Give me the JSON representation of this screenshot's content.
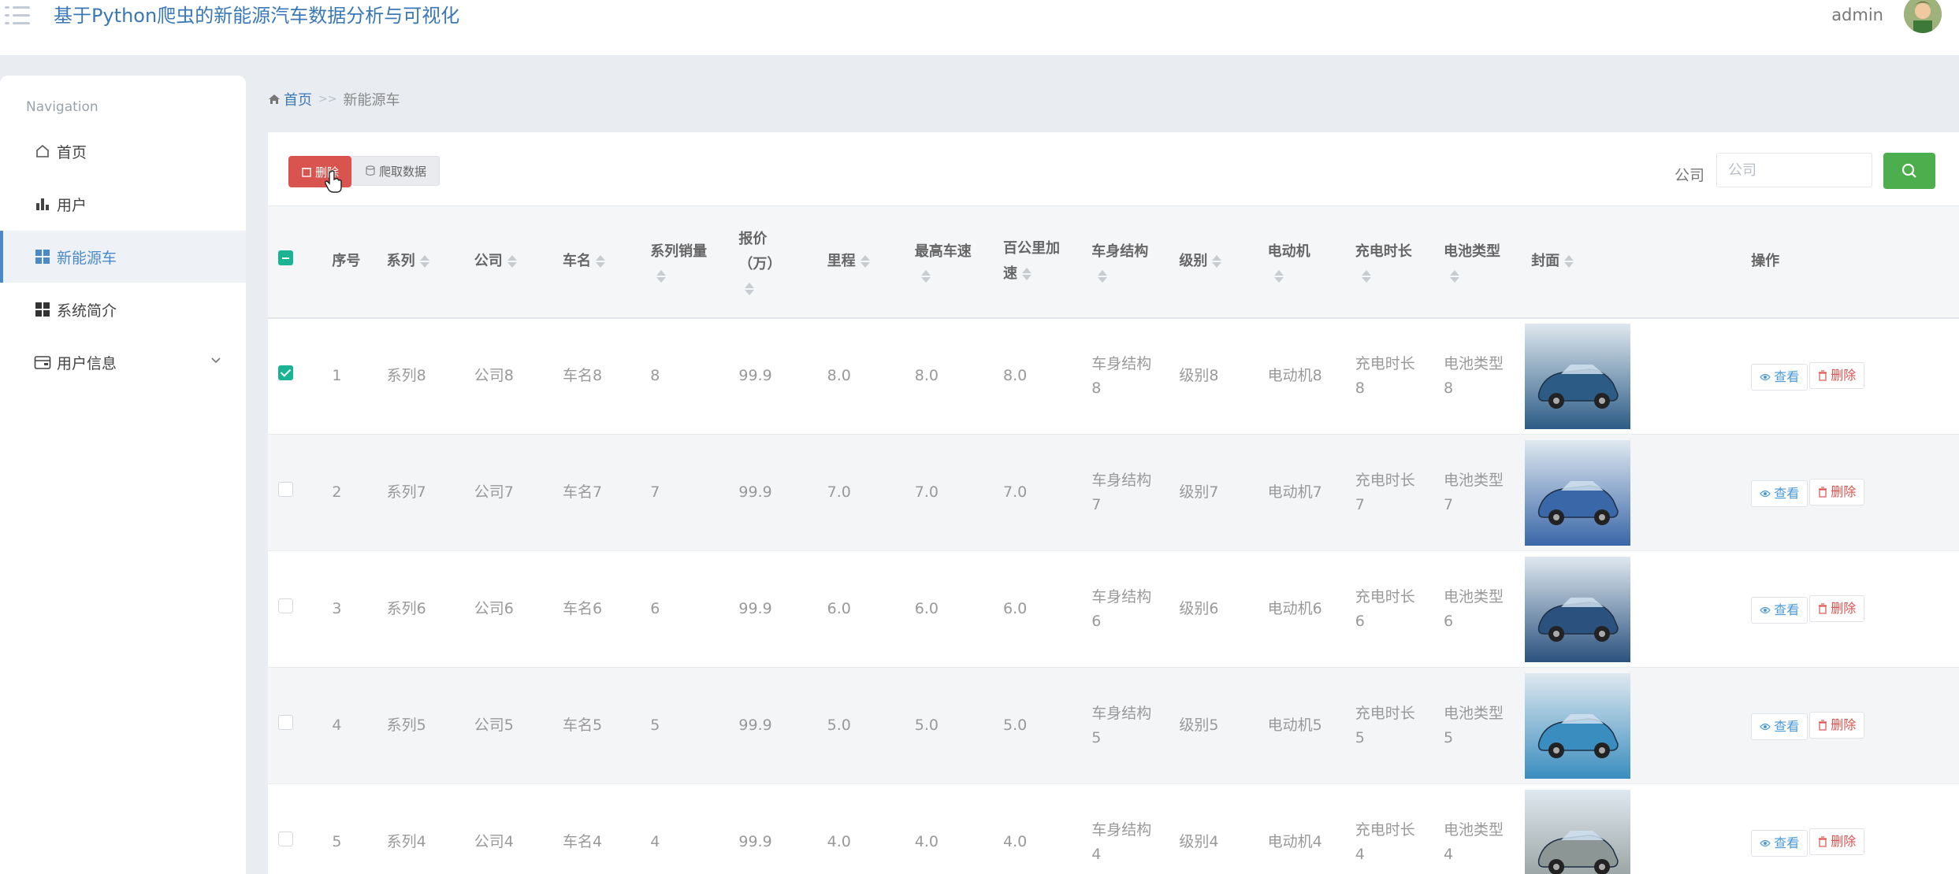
{
  "header": {
    "app_title": "基于Python爬虫的新能源汽车数据分析与可视化",
    "username": "admin",
    "menu_icon": "hamburger-icon",
    "avatar_icon": "user-avatar"
  },
  "sidebar": {
    "header": "Navigation",
    "items": [
      {
        "label": "首页",
        "icon": "home-icon"
      },
      {
        "label": "用户",
        "icon": "bar-chart-icon"
      },
      {
        "label": "新能源车",
        "icon": "grid-icon"
      },
      {
        "label": "系统简介",
        "icon": "grid-icon"
      },
      {
        "label": "用户信息",
        "icon": "wallet-icon"
      }
    ],
    "active_index": 2
  },
  "breadcrumb": {
    "home": "首页",
    "separator": ">>",
    "current": "新能源车"
  },
  "toolbar": {
    "delete_label": "删除",
    "crawl_label": "爬取数据",
    "search_label": "公司",
    "search_placeholder": "公司"
  },
  "table": {
    "headers": {
      "index": "序号",
      "series": "系列",
      "company": "公司",
      "car_name": "车名",
      "series_sales_1": "系列销量",
      "price_1": "报价",
      "price_2": "（万）",
      "range": "里程",
      "max_speed_1": "最高车速",
      "accel_1": "百公里加",
      "accel_2": "速",
      "body": "车身结构",
      "level": "级别",
      "motor": "电动机",
      "charge_time": "充电时长",
      "battery": "电池类型",
      "cover": "封面",
      "actions": "操作"
    },
    "rows": [
      {
        "checked": true,
        "index": "1",
        "series": "系列8",
        "company": "公司8",
        "car_name": "车名8",
        "sales": "8",
        "price": "99.9",
        "range": "8.0",
        "max_speed": "8.0",
        "accel": "8.0",
        "body_a": "车身结构",
        "body_b": "8",
        "level": "级别8",
        "motor": "电动机8",
        "charge_a": "充电时长",
        "charge_b": "8",
        "battery_a": "电池类型",
        "battery_b": "8",
        "cover_color": "#2c5c86"
      },
      {
        "checked": false,
        "index": "2",
        "series": "系列7",
        "company": "公司7",
        "car_name": "车名7",
        "sales": "7",
        "price": "99.9",
        "range": "7.0",
        "max_speed": "7.0",
        "accel": "7.0",
        "body_a": "车身结构",
        "body_b": "7",
        "level": "级别7",
        "motor": "电动机7",
        "charge_a": "充电时长",
        "charge_b": "7",
        "battery_a": "电池类型",
        "battery_b": "7",
        "cover_color": "#3a67a8"
      },
      {
        "checked": false,
        "index": "3",
        "series": "系列6",
        "company": "公司6",
        "car_name": "车名6",
        "sales": "6",
        "price": "99.9",
        "range": "6.0",
        "max_speed": "6.0",
        "accel": "6.0",
        "body_a": "车身结构",
        "body_b": "6",
        "level": "级别6",
        "motor": "电动机6",
        "charge_a": "充电时长",
        "charge_b": "6",
        "battery_a": "电池类型",
        "battery_b": "6",
        "cover_color": "#2b527e"
      },
      {
        "checked": false,
        "index": "4",
        "series": "系列5",
        "company": "公司5",
        "car_name": "车名5",
        "sales": "5",
        "price": "99.9",
        "range": "5.0",
        "max_speed": "5.0",
        "accel": "5.0",
        "body_a": "车身结构",
        "body_b": "5",
        "level": "级别5",
        "motor": "电动机5",
        "charge_a": "充电时长",
        "charge_b": "5",
        "battery_a": "电池类型",
        "battery_b": "5",
        "cover_color": "#3a8dbf"
      },
      {
        "checked": false,
        "index": "5",
        "series": "系列4",
        "company": "公司4",
        "car_name": "车名4",
        "sales": "4",
        "price": "99.9",
        "range": "4.0",
        "max_speed": "4.0",
        "accel": "4.0",
        "body_a": "车身结构",
        "body_b": "4",
        "level": "级别4",
        "motor": "电动机4",
        "charge_a": "充电时长",
        "charge_b": "4",
        "battery_a": "电池类型",
        "battery_b": "4",
        "cover_color": "#8c9694"
      }
    ],
    "view_label": "查看",
    "delete_label": "删除"
  },
  "colors": {
    "accent": "#4a89c7",
    "danger": "#d9534f",
    "success": "#4cae4c",
    "checkbox": "#1ab394"
  }
}
